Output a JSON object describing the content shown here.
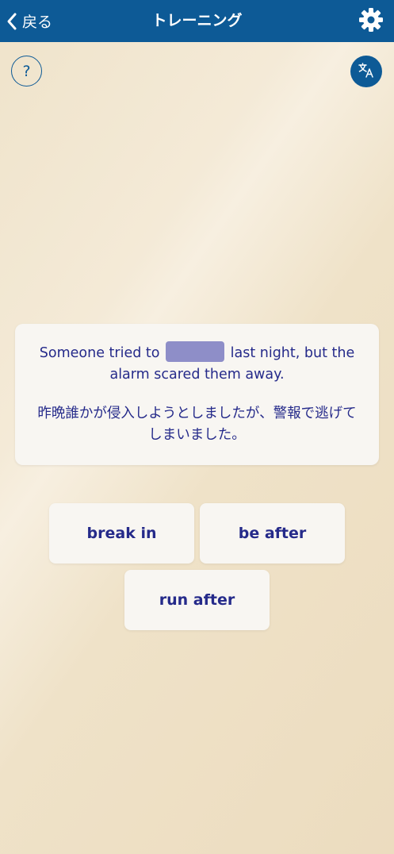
{
  "header": {
    "back_label": "戻る",
    "title": "トレーニング"
  },
  "help": {
    "label": "?"
  },
  "question": {
    "sentence_before": "Someone tried to",
    "sentence_after": "last night, but the alarm scared them away.",
    "translation": "昨晩誰かが侵入しようとしましたが、警報で逃げてしまいました。"
  },
  "options": [
    {
      "label": "break in"
    },
    {
      "label": "be after"
    },
    {
      "label": "run after"
    }
  ],
  "icons": {
    "back": "chevron-left-icon",
    "settings": "gear-icon",
    "translate": "translate-icon"
  },
  "colors": {
    "header_bg": "#0d5a96",
    "text_primary": "#252a8a",
    "blank_fill": "#8e8ec8",
    "card_bg": "#f8f6f2"
  }
}
